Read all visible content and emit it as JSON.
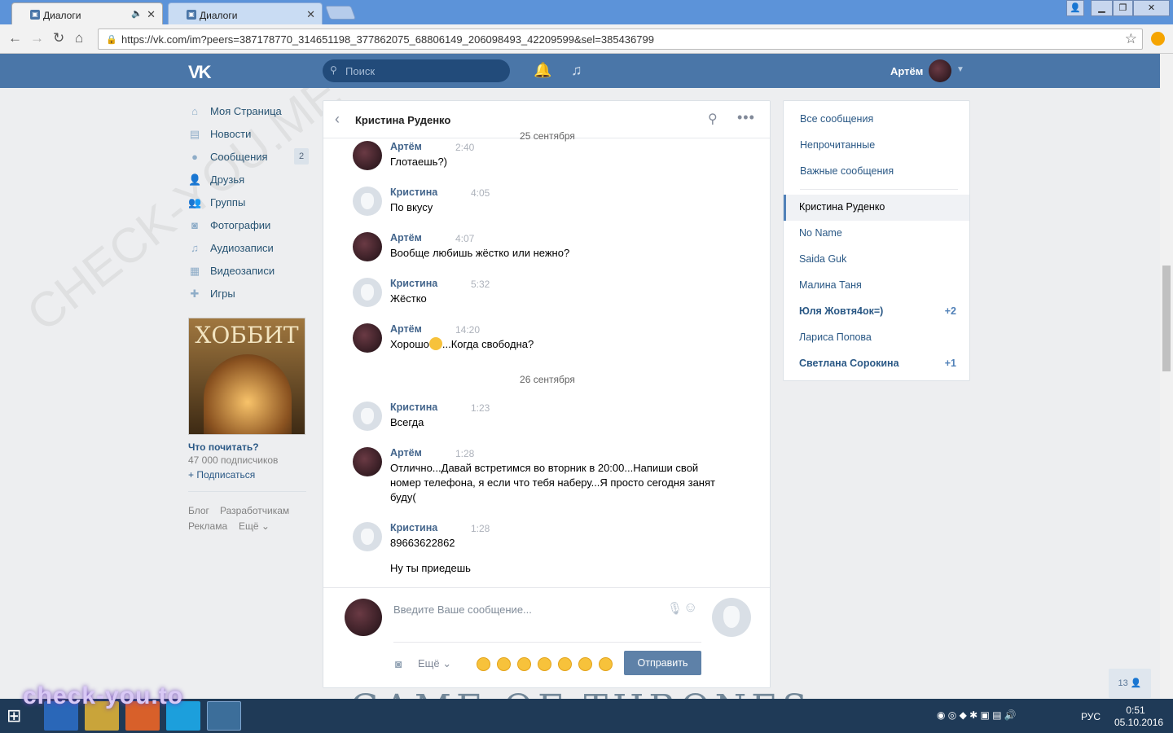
{
  "browser": {
    "tabs": [
      {
        "title": "Диалоги",
        "active": true
      },
      {
        "title": "Диалоги",
        "active": false
      }
    ],
    "url": "https://vk.com/im?peers=387178770_314651198_377862075_68806149_206098493_42209599&sel=385436799"
  },
  "header": {
    "logo": "VK",
    "search_placeholder": "Поиск",
    "user_name": "Артём",
    "brand_color": "#4a76a8"
  },
  "left_menu": {
    "items": [
      {
        "label": "Моя Страница",
        "icon": "home-icon"
      },
      {
        "label": "Новости",
        "icon": "news-icon"
      },
      {
        "label": "Сообщения",
        "icon": "messages-icon",
        "count": "2"
      },
      {
        "label": "Друзья",
        "icon": "friends-icon"
      },
      {
        "label": "Группы",
        "icon": "groups-icon"
      },
      {
        "label": "Фотографии",
        "icon": "camera-icon"
      },
      {
        "label": "Аудиозаписи",
        "icon": "music-note-icon"
      },
      {
        "label": "Видеозаписи",
        "icon": "film-icon"
      },
      {
        "label": "Игры",
        "icon": "gamepad-icon"
      }
    ],
    "ad": {
      "image_text": "ХОББИТ",
      "title": "Что почитать?",
      "subscribers": "47 000 подписчиков",
      "subscribe": "+ Подписаться"
    },
    "footer": {
      "blog": "Блог",
      "dev": "Разработчикам",
      "ads": "Реклама",
      "more": "Ещё"
    }
  },
  "chat": {
    "peer_name": "Кристина Руденко",
    "date1": "25 сентября",
    "date2": "26 сентября",
    "messages": [
      {
        "author": "Артём",
        "time": "2:40",
        "text": "Глотаешь?)"
      },
      {
        "author": "Кристина",
        "time": "4:05",
        "text": "По вкусу"
      },
      {
        "author": "Артём",
        "time": "4:07",
        "text": "Вообще любишь жёстко или нежно?"
      },
      {
        "author": "Кристина",
        "time": "5:32",
        "text": "Жёстко"
      },
      {
        "author": "Артём",
        "time": "14:20",
        "text_a": "Хорошо",
        "text_b": "...Когда свободна?"
      },
      {
        "author": "Кристина",
        "time": "1:23",
        "text": "Всегда"
      },
      {
        "author": "Артём",
        "time": "1:28",
        "text": "Отлично...Давай встретимся во вторник в 20:00...Напиши свой номер телефона, я если что тебя наберу...Я просто сегодня занят буду("
      },
      {
        "author": "Кристина",
        "time": "1:28",
        "text": "89663622862",
        "text2": "Ну ты приедешь"
      }
    ],
    "composer": {
      "placeholder": "Введите Ваше сообщение...",
      "more": "Ещё",
      "send": "Отправить"
    }
  },
  "right_panel": {
    "filters": [
      "Все сообщения",
      "Непрочитанные",
      "Важные сообщения"
    ],
    "dialogs": [
      {
        "name": "Кристина Руденко",
        "selected": true
      },
      {
        "name": "No Name"
      },
      {
        "name": "Saida Guk"
      },
      {
        "name": "Малина Таня"
      },
      {
        "name": "Юля Жовтя4ок=)",
        "count": "+2",
        "bold": true
      },
      {
        "name": "Лариса Попова"
      },
      {
        "name": "Светлана Сорокина",
        "count": "+1",
        "bold": true
      }
    ]
  },
  "chat_notif": "13",
  "background_text": "GAME OF THRONES",
  "watermark": "check-you.to",
  "taskbar": {
    "lang": "РУС",
    "time": "0:51",
    "date": "05.10.2016"
  }
}
